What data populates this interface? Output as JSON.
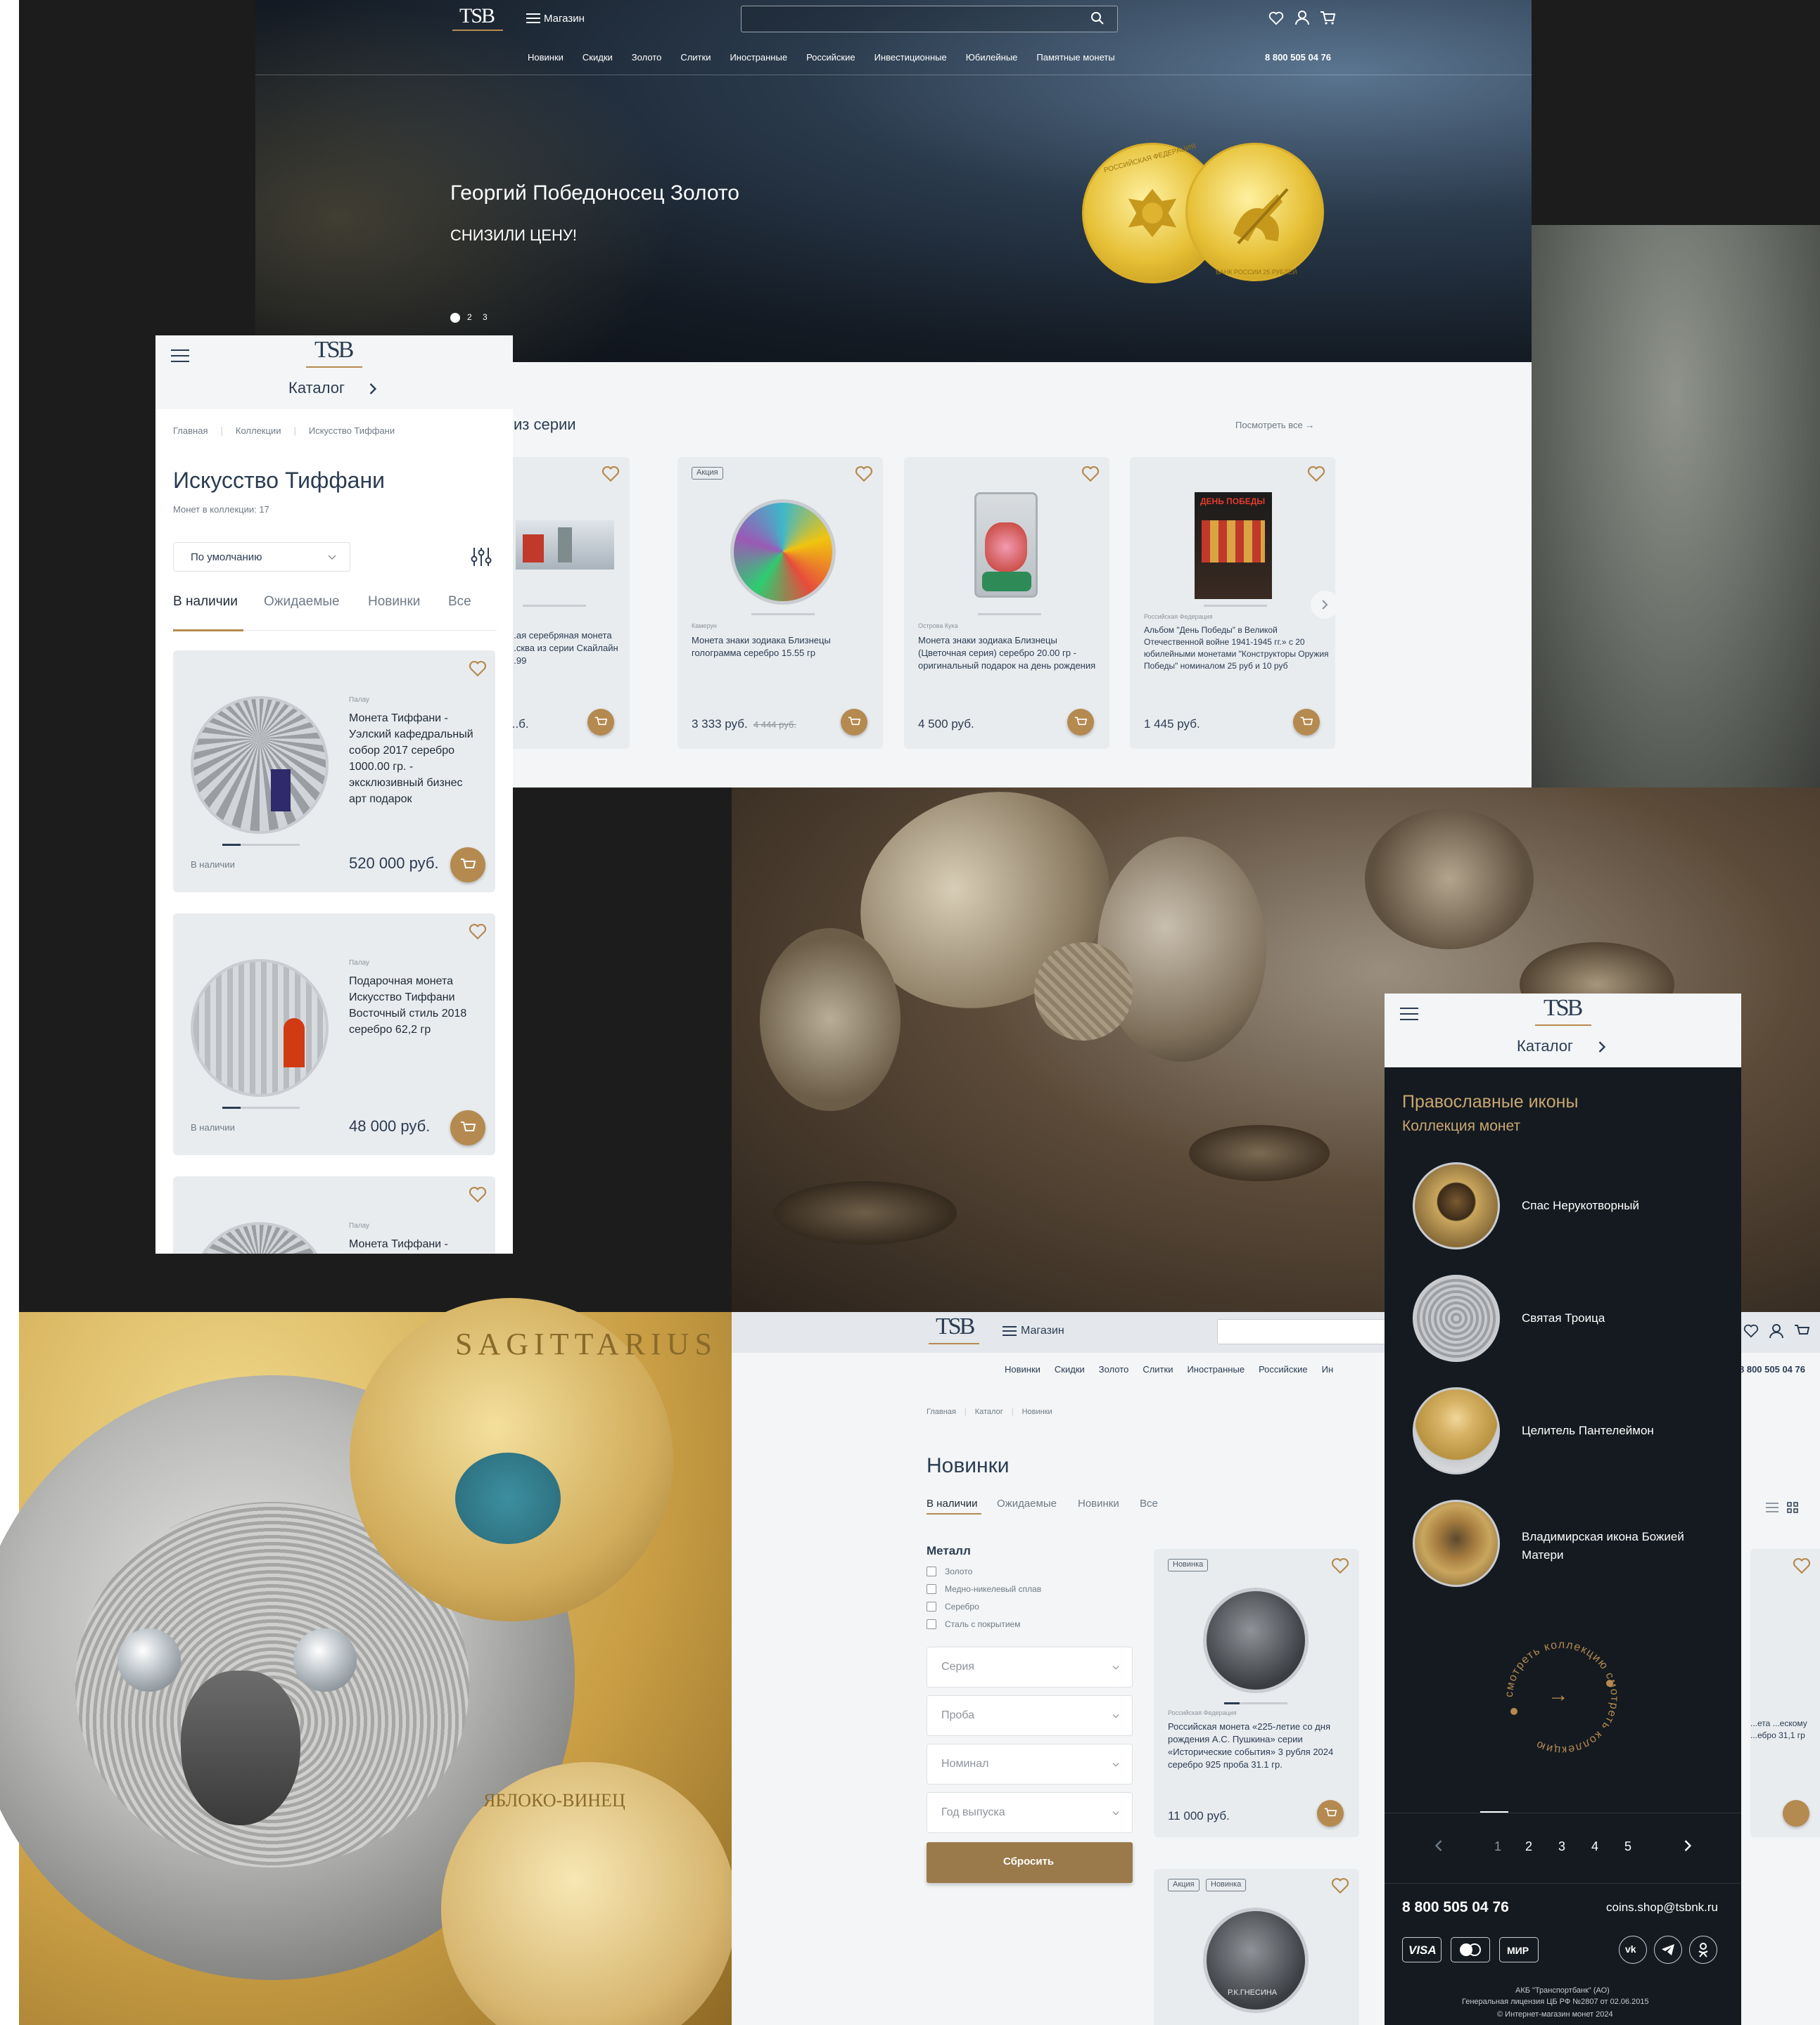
{
  "desktop": {
    "header": {
      "logo": "TSB",
      "menu_label": "Магазин",
      "phone": "8 800 505 04 76",
      "nav": [
        "Новинки",
        "Скидки",
        "Золото",
        "Слитки",
        "Иностранные",
        "Российские",
        "Инвестиционные",
        "Юбилейные",
        "Памятные монеты"
      ]
    },
    "hero": {
      "title": "Георгий Победоносец Золото",
      "subtitle": "СНИЗИЛИ ЦЕНУ!",
      "slides": [
        "2",
        "3"
      ],
      "coin_obverse": "РОССИЙСКАЯ ФЕДЕРАЦИЯ",
      "coin_reverse": "БАНК РОССИИ 25 РУБЛЕЙ"
    },
    "series": {
      "title": "из серии",
      "see_all": "Посмотреть все →",
      "cards": [
        {
          "badge": "",
          "country": "",
          "name": "...ая серебряная монета ...сква из серии Скайлайн ...99",
          "price": "...б.",
          "old_price": ""
        },
        {
          "badge": "Акция",
          "country": "Камерун",
          "name": "Монета знаки зодиака Близнецы голограмма серебро 15.55 гр",
          "price": "3 333 руб.",
          "old_price": "4 444 руб."
        },
        {
          "badge": "",
          "country": "Острова Кука",
          "name": "Монета знаки зодиака Близнецы (Цветочная серия) серебро 20.00 гр - оригинальный подарок на день рождения",
          "price": "4 500 руб.",
          "old_price": ""
        },
        {
          "badge": "",
          "country": "Российская Федерация",
          "name": "Альбом \"День Победы\" в Великой Отечественной войне 1941-1945 гг.» с 20 юбилейными монетами \"Конструкторы Оружия Победы\" номиналом 25 руб и 10 руб",
          "price": "1 445 руб.",
          "old_price": "",
          "album_label": "ДЕНЬ ПОБЕДЫ"
        }
      ]
    }
  },
  "mobile1": {
    "logo": "TSB",
    "catalog": "Каталог",
    "breadcrumbs": [
      "Главная",
      "Коллекции",
      "Искусство Тиффани"
    ],
    "title": "Искусство Тиффани",
    "count": "Монет в коллекции: 17",
    "sort": "По умолчанию",
    "tabs": [
      "В наличии",
      "Ожидаемые",
      "Новинки",
      "Все"
    ],
    "products": [
      {
        "country": "Палау",
        "name": "Монета Тиффани - Уэлский кафедральный собор 2017 серебро 1000.00 гр. - эксклюзивный бизнес арт подарок",
        "status": "В наличии",
        "price": "520 000 руб."
      },
      {
        "country": "Палау",
        "name": "Подарочная монета Искусство Тиффани Восточный стиль 2018 серебро 62,2 гр",
        "status": "В наличии",
        "price": "48 000 руб."
      },
      {
        "country": "Палау",
        "name": "Монета Тиффани -",
        "status": "",
        "price": ""
      }
    ]
  },
  "desktop2": {
    "logo": "TSB",
    "menu_label": "Магазин",
    "phone": "8 800 505 04 76",
    "nav": [
      "Новинки",
      "Скидки",
      "Золото",
      "Слитки",
      "Иностранные",
      "Российские",
      "Ин"
    ],
    "breadcrumbs": [
      "Главная",
      "Каталог",
      "Новинки"
    ],
    "title": "Новинки",
    "tabs": [
      "В наличии",
      "Ожидаемые",
      "Новинки",
      "Все"
    ],
    "filter": {
      "metal_title": "Металл",
      "metals": [
        "Золото",
        "Медно-никелевый сплав",
        "Серебро",
        "Сталь с покрытием"
      ],
      "selects": [
        "Серия",
        "Проба",
        "Номинал",
        "Год выпуска"
      ],
      "reset": "Сбросить"
    },
    "card1": {
      "badge": "Новинка",
      "country": "Российская Федерация",
      "name": "Российская монета «225-летие со дня рождения А.С. Пушкина» серии «Исторические события» 3 рубля 2024 серебро 925 проба 31.1 гр.",
      "price": "11 000 руб."
    },
    "card2": {
      "badges": [
        "Акция",
        "Новинка"
      ],
      "coin_text": "Р.К.ГНЕСИНА"
    },
    "right_card": {
      "name": "...ета ...ескому ...ебро 31,1 гр"
    }
  },
  "mobile2": {
    "logo": "TSB",
    "catalog": "Каталог",
    "title": "Православные иконы",
    "subtitle": "Коллекция монет",
    "icons": [
      "Спас Нерукотворный",
      "Святая Троица",
      "Целитель Пантелеймон",
      "Владимирская икона Божией Матери"
    ],
    "circle_text": "смотреть коллекцию смотреть коллекцию",
    "arrow": "→",
    "pages": [
      "1",
      "2",
      "3",
      "4",
      "5"
    ],
    "phone": "8 800 505 04 76",
    "email": "coins.shop@tsbnk.ru",
    "payments": [
      "VISA",
      "",
      "МИР"
    ],
    "socials": [
      "vk",
      "telegram",
      "ok"
    ],
    "legal": [
      "АКБ \"Транспортбанк\" (АО)",
      "Генеральная лицензия ЦБ РФ №2807 от 02.06.2015",
      "© Интернет-магазин монет 2024"
    ]
  },
  "eagle_coin": {
    "side_text": "SAGITTARIUS",
    "hummingbird_text": "ЯБЛОКО-ВИНЕЦ"
  },
  "colors": {
    "accent": "#b58a50",
    "dark_panel": "#141a20",
    "text": "#1f2a36",
    "muted": "#8d949b",
    "link": "#2b3c52"
  }
}
